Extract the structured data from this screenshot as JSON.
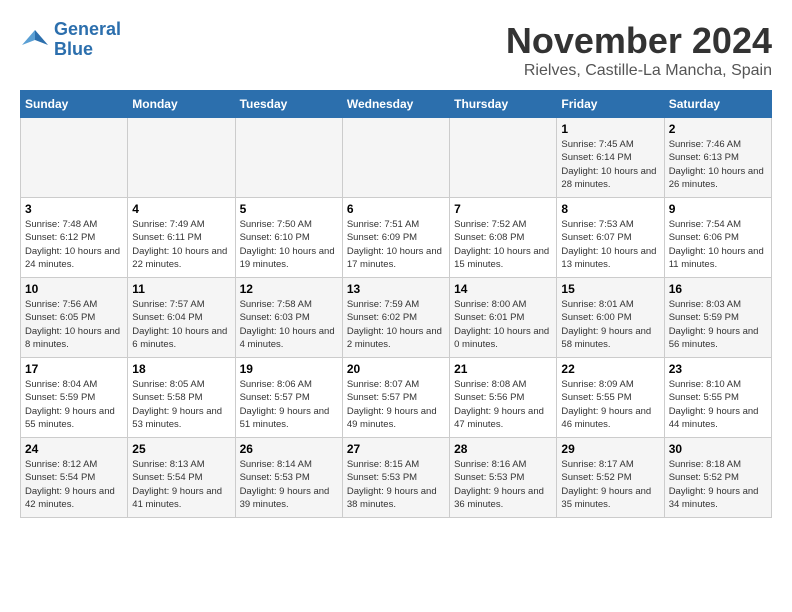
{
  "logo": {
    "text_line1": "General",
    "text_line2": "Blue"
  },
  "title": "November 2024",
  "location": "Rielves, Castille-La Mancha, Spain",
  "days_of_week": [
    "Sunday",
    "Monday",
    "Tuesday",
    "Wednesday",
    "Thursday",
    "Friday",
    "Saturday"
  ],
  "weeks": [
    [
      {
        "day": "",
        "sunrise": "",
        "sunset": "",
        "daylight": ""
      },
      {
        "day": "",
        "sunrise": "",
        "sunset": "",
        "daylight": ""
      },
      {
        "day": "",
        "sunrise": "",
        "sunset": "",
        "daylight": ""
      },
      {
        "day": "",
        "sunrise": "",
        "sunset": "",
        "daylight": ""
      },
      {
        "day": "",
        "sunrise": "",
        "sunset": "",
        "daylight": ""
      },
      {
        "day": "1",
        "sunrise": "Sunrise: 7:45 AM",
        "sunset": "Sunset: 6:14 PM",
        "daylight": "Daylight: 10 hours and 28 minutes."
      },
      {
        "day": "2",
        "sunrise": "Sunrise: 7:46 AM",
        "sunset": "Sunset: 6:13 PM",
        "daylight": "Daylight: 10 hours and 26 minutes."
      }
    ],
    [
      {
        "day": "3",
        "sunrise": "Sunrise: 7:48 AM",
        "sunset": "Sunset: 6:12 PM",
        "daylight": "Daylight: 10 hours and 24 minutes."
      },
      {
        "day": "4",
        "sunrise": "Sunrise: 7:49 AM",
        "sunset": "Sunset: 6:11 PM",
        "daylight": "Daylight: 10 hours and 22 minutes."
      },
      {
        "day": "5",
        "sunrise": "Sunrise: 7:50 AM",
        "sunset": "Sunset: 6:10 PM",
        "daylight": "Daylight: 10 hours and 19 minutes."
      },
      {
        "day": "6",
        "sunrise": "Sunrise: 7:51 AM",
        "sunset": "Sunset: 6:09 PM",
        "daylight": "Daylight: 10 hours and 17 minutes."
      },
      {
        "day": "7",
        "sunrise": "Sunrise: 7:52 AM",
        "sunset": "Sunset: 6:08 PM",
        "daylight": "Daylight: 10 hours and 15 minutes."
      },
      {
        "day": "8",
        "sunrise": "Sunrise: 7:53 AM",
        "sunset": "Sunset: 6:07 PM",
        "daylight": "Daylight: 10 hours and 13 minutes."
      },
      {
        "day": "9",
        "sunrise": "Sunrise: 7:54 AM",
        "sunset": "Sunset: 6:06 PM",
        "daylight": "Daylight: 10 hours and 11 minutes."
      }
    ],
    [
      {
        "day": "10",
        "sunrise": "Sunrise: 7:56 AM",
        "sunset": "Sunset: 6:05 PM",
        "daylight": "Daylight: 10 hours and 8 minutes."
      },
      {
        "day": "11",
        "sunrise": "Sunrise: 7:57 AM",
        "sunset": "Sunset: 6:04 PM",
        "daylight": "Daylight: 10 hours and 6 minutes."
      },
      {
        "day": "12",
        "sunrise": "Sunrise: 7:58 AM",
        "sunset": "Sunset: 6:03 PM",
        "daylight": "Daylight: 10 hours and 4 minutes."
      },
      {
        "day": "13",
        "sunrise": "Sunrise: 7:59 AM",
        "sunset": "Sunset: 6:02 PM",
        "daylight": "Daylight: 10 hours and 2 minutes."
      },
      {
        "day": "14",
        "sunrise": "Sunrise: 8:00 AM",
        "sunset": "Sunset: 6:01 PM",
        "daylight": "Daylight: 10 hours and 0 minutes."
      },
      {
        "day": "15",
        "sunrise": "Sunrise: 8:01 AM",
        "sunset": "Sunset: 6:00 PM",
        "daylight": "Daylight: 9 hours and 58 minutes."
      },
      {
        "day": "16",
        "sunrise": "Sunrise: 8:03 AM",
        "sunset": "Sunset: 5:59 PM",
        "daylight": "Daylight: 9 hours and 56 minutes."
      }
    ],
    [
      {
        "day": "17",
        "sunrise": "Sunrise: 8:04 AM",
        "sunset": "Sunset: 5:59 PM",
        "daylight": "Daylight: 9 hours and 55 minutes."
      },
      {
        "day": "18",
        "sunrise": "Sunrise: 8:05 AM",
        "sunset": "Sunset: 5:58 PM",
        "daylight": "Daylight: 9 hours and 53 minutes."
      },
      {
        "day": "19",
        "sunrise": "Sunrise: 8:06 AM",
        "sunset": "Sunset: 5:57 PM",
        "daylight": "Daylight: 9 hours and 51 minutes."
      },
      {
        "day": "20",
        "sunrise": "Sunrise: 8:07 AM",
        "sunset": "Sunset: 5:57 PM",
        "daylight": "Daylight: 9 hours and 49 minutes."
      },
      {
        "day": "21",
        "sunrise": "Sunrise: 8:08 AM",
        "sunset": "Sunset: 5:56 PM",
        "daylight": "Daylight: 9 hours and 47 minutes."
      },
      {
        "day": "22",
        "sunrise": "Sunrise: 8:09 AM",
        "sunset": "Sunset: 5:55 PM",
        "daylight": "Daylight: 9 hours and 46 minutes."
      },
      {
        "day": "23",
        "sunrise": "Sunrise: 8:10 AM",
        "sunset": "Sunset: 5:55 PM",
        "daylight": "Daylight: 9 hours and 44 minutes."
      }
    ],
    [
      {
        "day": "24",
        "sunrise": "Sunrise: 8:12 AM",
        "sunset": "Sunset: 5:54 PM",
        "daylight": "Daylight: 9 hours and 42 minutes."
      },
      {
        "day": "25",
        "sunrise": "Sunrise: 8:13 AM",
        "sunset": "Sunset: 5:54 PM",
        "daylight": "Daylight: 9 hours and 41 minutes."
      },
      {
        "day": "26",
        "sunrise": "Sunrise: 8:14 AM",
        "sunset": "Sunset: 5:53 PM",
        "daylight": "Daylight: 9 hours and 39 minutes."
      },
      {
        "day": "27",
        "sunrise": "Sunrise: 8:15 AM",
        "sunset": "Sunset: 5:53 PM",
        "daylight": "Daylight: 9 hours and 38 minutes."
      },
      {
        "day": "28",
        "sunrise": "Sunrise: 8:16 AM",
        "sunset": "Sunset: 5:53 PM",
        "daylight": "Daylight: 9 hours and 36 minutes."
      },
      {
        "day": "29",
        "sunrise": "Sunrise: 8:17 AM",
        "sunset": "Sunset: 5:52 PM",
        "daylight": "Daylight: 9 hours and 35 minutes."
      },
      {
        "day": "30",
        "sunrise": "Sunrise: 8:18 AM",
        "sunset": "Sunset: 5:52 PM",
        "daylight": "Daylight: 9 hours and 34 minutes."
      }
    ]
  ]
}
